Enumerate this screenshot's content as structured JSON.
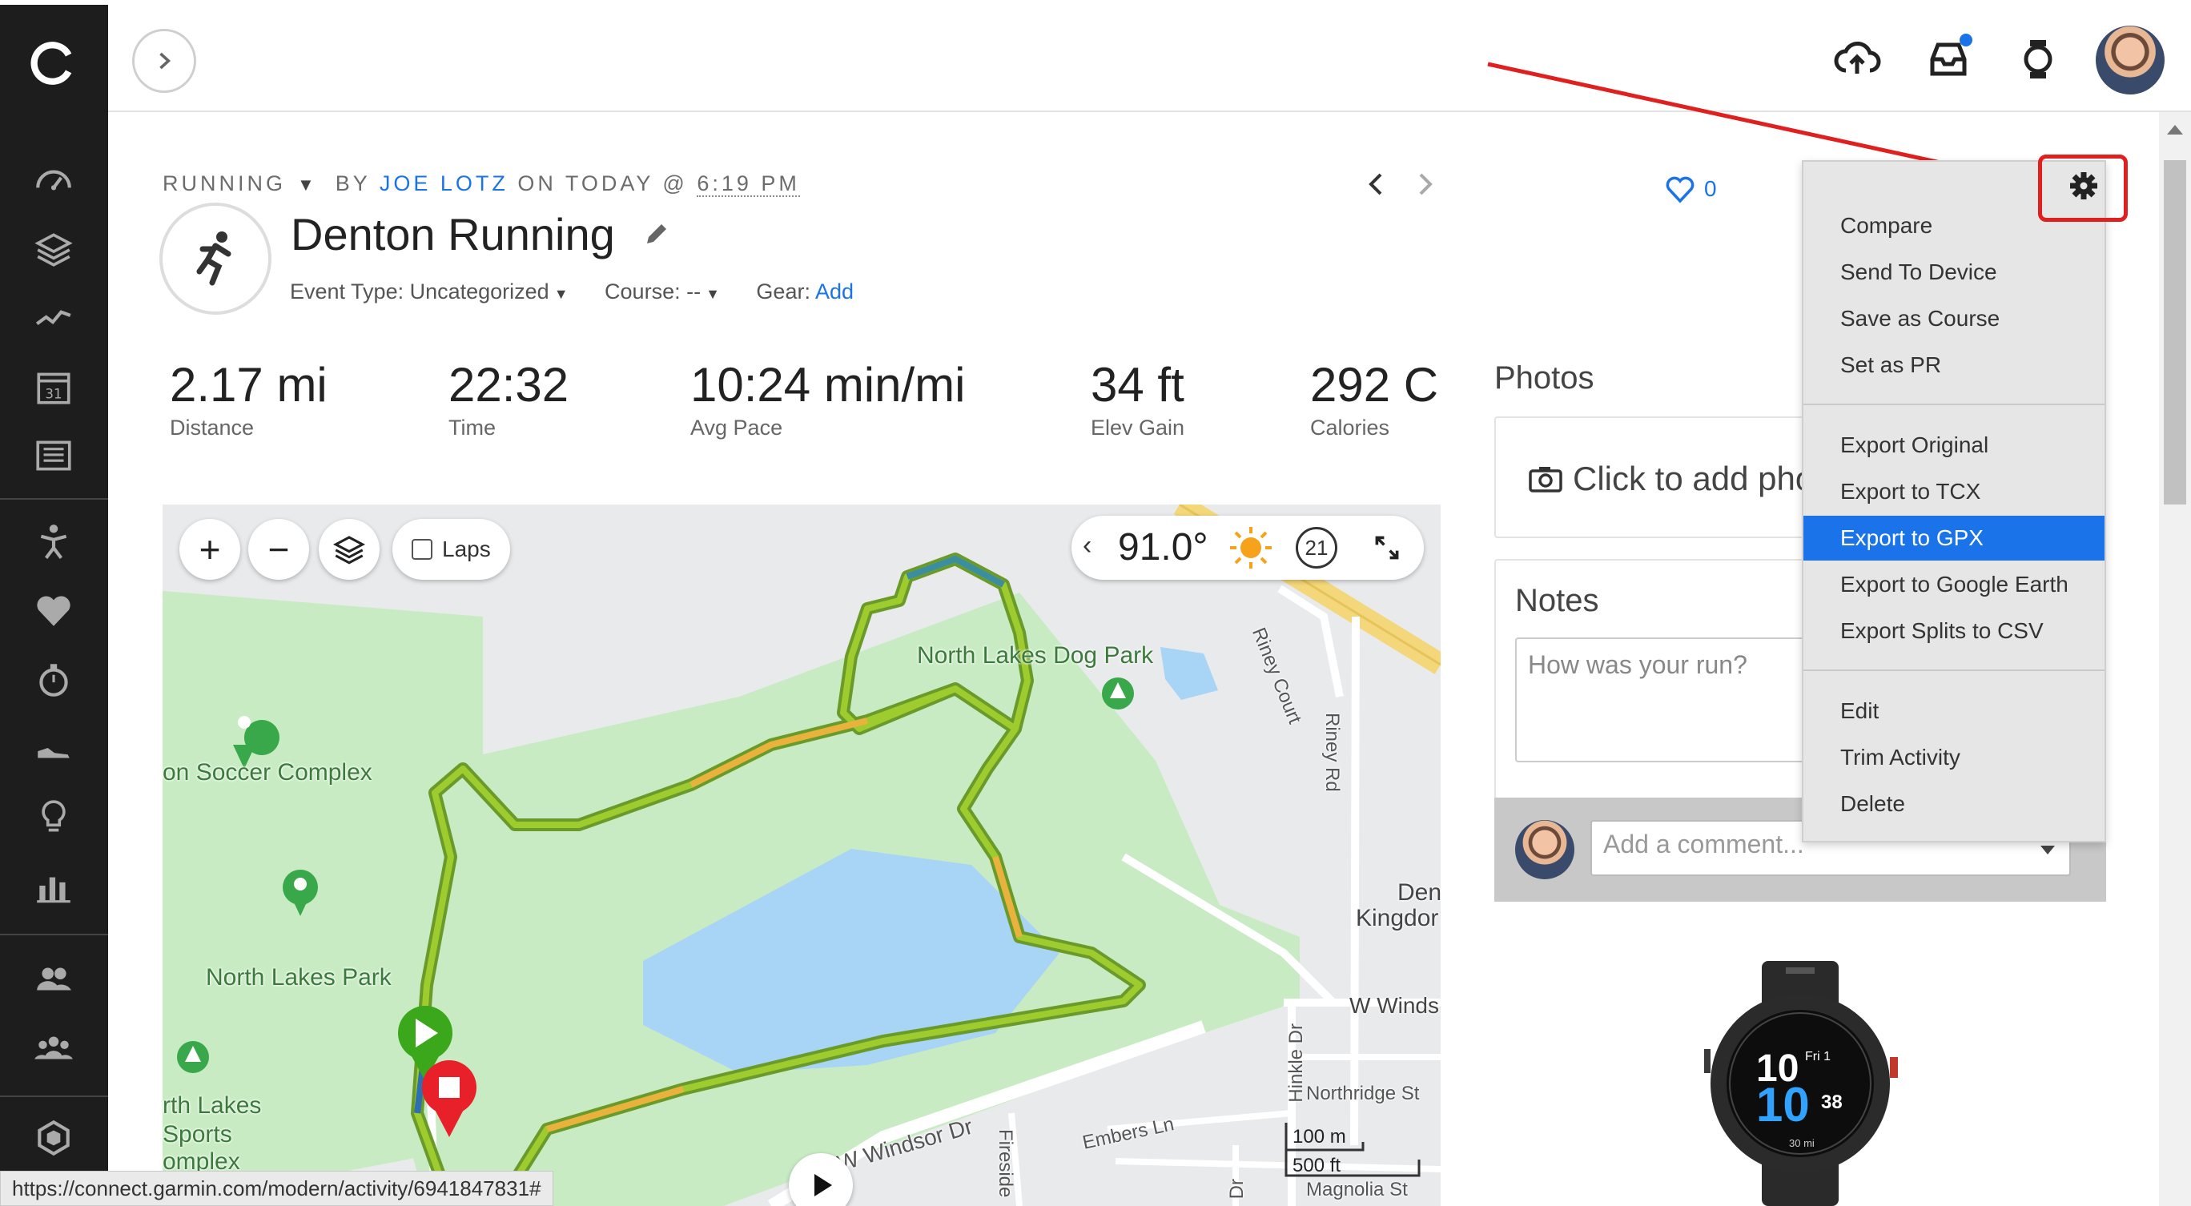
{
  "activity": {
    "type_label": "RUNNING",
    "by": "BY",
    "author": "JOE LOTZ",
    "on": "ON TODAY @",
    "time": "6:19 PM",
    "title": "Denton Running",
    "event_type": "Event Type: Uncategorized",
    "course": "Course: --",
    "gear_label": "Gear:",
    "gear_link": "Add",
    "likes": "0"
  },
  "stats": [
    {
      "value": "2.17 mi",
      "label": "Distance"
    },
    {
      "value": "22:32",
      "label": "Time"
    },
    {
      "value": "10:24 min/mi",
      "label": "Avg Pace"
    },
    {
      "value": "34 ft",
      "label": "Elev Gain"
    },
    {
      "value": "292 C",
      "label": "Calories"
    }
  ],
  "map": {
    "laps_label": "Laps",
    "temperature": "91.0°",
    "wind": "21",
    "labels": {
      "dog_park": "North Lakes Dog Park",
      "soccer": "on Soccer Complex",
      "north_lakes_park": "North Lakes Park",
      "sports_1": "rth Lakes",
      "sports_2": "Sports",
      "sports_3": "omplex",
      "riney_court": "Riney Court",
      "riney_rd": "Riney Rd",
      "den": "Den",
      "kingdom": "Kingdor",
      "w_winds": "W Winds",
      "northridge": "Northridge St",
      "hinkle": "Hinkle Dr",
      "windsor": "W Windsor Dr",
      "embers": "Embers Ln",
      "fireside": "Fireside",
      "magnolia": "Magnolia St",
      "dr": "Dr"
    },
    "scale_m": "100 m",
    "scale_ft": "500 ft"
  },
  "right": {
    "photos_title": "Photos",
    "photos_prompt": "Click to add pho",
    "notes_title": "Notes",
    "notes_placeholder": "How was your run?",
    "comment_placeholder": "Add a comment..."
  },
  "gear_menu": {
    "group1": [
      "Compare",
      "Send To Device",
      "Save as Course",
      "Set as PR"
    ],
    "group2": [
      "Export Original",
      "Export to TCX",
      "Export to GPX",
      "Export to Google Earth",
      "Export Splits to CSV"
    ],
    "group3": [
      "Edit",
      "Trim Activity",
      "Delete"
    ],
    "active": "Export to GPX"
  },
  "watch": {
    "hour": "10",
    "minute": "10",
    "day": "Fri 1",
    "seconds": "38",
    "distance": "30 mi"
  },
  "status_url": "https://connect.garmin.com/modern/activity/6941847831#",
  "colors": {
    "accent": "#1a73e8",
    "sidebar": "#1d1d1d",
    "annotation": "#e0201e",
    "park_green": "#c8ebc4",
    "lake_blue": "#a8d4f5"
  }
}
